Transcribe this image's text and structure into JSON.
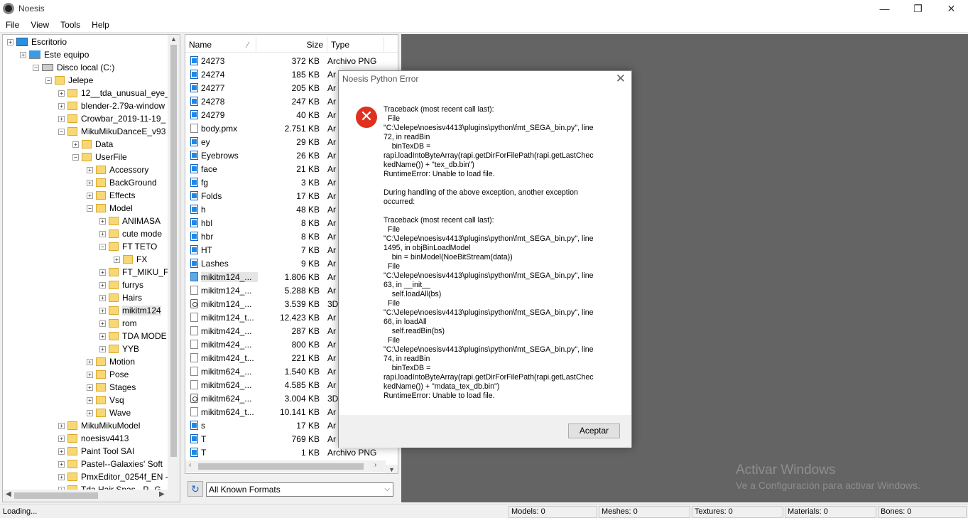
{
  "window": {
    "title": "Noesis",
    "minimize": "—",
    "restore": "❐",
    "close": "✕"
  },
  "menu": [
    "File",
    "View",
    "Tools",
    "Help"
  ],
  "tree": {
    "items": [
      {
        "label": "Escritorio",
        "exp": "+"
      },
      {
        "label": "Este equipo",
        "exp": "+"
      },
      {
        "label": "Disco local (C:)",
        "exp": "−"
      },
      {
        "label": "Jelepe",
        "exp": "−"
      },
      {
        "label": "12__tda_unusual_eye_",
        "exp": "+"
      },
      {
        "label": "blender-2.79a-window",
        "exp": "+"
      },
      {
        "label": "Crowbar_2019-11-19_",
        "exp": "+"
      },
      {
        "label": "MikuMikuDanceE_v93",
        "exp": "−"
      },
      {
        "label": "Data",
        "exp": "+"
      },
      {
        "label": "UserFile",
        "exp": "−"
      },
      {
        "label": "Accessory",
        "exp": "+"
      },
      {
        "label": "BackGround",
        "exp": "+"
      },
      {
        "label": "Effects",
        "exp": "+"
      },
      {
        "label": "Model",
        "exp": "−"
      },
      {
        "label": "ANIMASA",
        "exp": "+"
      },
      {
        "label": "cute mode",
        "exp": "+"
      },
      {
        "label": "FT TETO",
        "exp": "−"
      },
      {
        "label": "FX",
        "exp": "+"
      },
      {
        "label": "FT_MIKU_F",
        "exp": "+"
      },
      {
        "label": "furrys",
        "exp": "+"
      },
      {
        "label": "Hairs",
        "exp": "+"
      },
      {
        "label": "mikitm124",
        "exp": "+"
      },
      {
        "label": "rom",
        "exp": "+"
      },
      {
        "label": "TDA MODE",
        "exp": "+"
      },
      {
        "label": "YYB",
        "exp": "+"
      },
      {
        "label": "Motion",
        "exp": "+"
      },
      {
        "label": "Pose",
        "exp": "+"
      },
      {
        "label": "Stages",
        "exp": "+"
      },
      {
        "label": "Vsq",
        "exp": "+"
      },
      {
        "label": "Wave",
        "exp": "+"
      },
      {
        "label": "MikuMikuModel",
        "exp": "+"
      },
      {
        "label": "noesisv4413",
        "exp": "+"
      },
      {
        "label": "Paint Tool SAI",
        "exp": "+"
      },
      {
        "label": "Pastel--Galaxies' Soft",
        "exp": "+"
      },
      {
        "label": "PmxEditor_0254f_EN -",
        "exp": "+"
      },
      {
        "label": "Tda Hair Spas - P--G",
        "exp": "+"
      }
    ]
  },
  "file_list": {
    "headers": {
      "name": "Name",
      "size": "Size",
      "type": "Type"
    },
    "rows": [
      {
        "name": "24273",
        "size": "372 KB",
        "type": "Archivo PNG",
        "icon": "img"
      },
      {
        "name": "24274",
        "size": "185 KB",
        "type": "Ar",
        "icon": "img"
      },
      {
        "name": "24277",
        "size": "205 KB",
        "type": "Ar",
        "icon": "img"
      },
      {
        "name": "24278",
        "size": "247 KB",
        "type": "Ar",
        "icon": "img"
      },
      {
        "name": "24279",
        "size": "40 KB",
        "type": "Ar",
        "icon": "img"
      },
      {
        "name": "body.pmx",
        "size": "2.751 KB",
        "type": "Ar",
        "icon": "blank"
      },
      {
        "name": "ey",
        "size": "29 KB",
        "type": "Ar",
        "icon": "img"
      },
      {
        "name": "Eyebrows",
        "size": "26 KB",
        "type": "Ar",
        "icon": "img"
      },
      {
        "name": "face",
        "size": "21 KB",
        "type": "Ar",
        "icon": "img"
      },
      {
        "name": "fg",
        "size": "3 KB",
        "type": "Ar",
        "icon": "img"
      },
      {
        "name": "Folds",
        "size": "17 KB",
        "type": "Ar",
        "icon": "img"
      },
      {
        "name": "h",
        "size": "48 KB",
        "type": "Ar",
        "icon": "img"
      },
      {
        "name": "hbl",
        "size": "8 KB",
        "type": "Ar",
        "icon": "img"
      },
      {
        "name": "hbr",
        "size": "8 KB",
        "type": "Ar",
        "icon": "img"
      },
      {
        "name": "HT",
        "size": "7 KB",
        "type": "Ar",
        "icon": "img"
      },
      {
        "name": "Lashes",
        "size": "9 KB",
        "type": "Ar",
        "icon": "img"
      },
      {
        "name": "mikitm124_...",
        "size": "1.806 KB",
        "type": "Ar",
        "icon": "fill",
        "selected": true
      },
      {
        "name": "mikitm124_...",
        "size": "5.288 KB",
        "type": "Ar",
        "icon": "blank"
      },
      {
        "name": "mikitm124_...",
        "size": "3.539 KB",
        "type": "3D",
        "icon": "obj"
      },
      {
        "name": "mikitm124_t...",
        "size": "12.423 KB",
        "type": "Ar",
        "icon": "blank"
      },
      {
        "name": "mikitm424_...",
        "size": "287 KB",
        "type": "Ar",
        "icon": "blank"
      },
      {
        "name": "mikitm424_...",
        "size": "800 KB",
        "type": "Ar",
        "icon": "blank"
      },
      {
        "name": "mikitm424_t...",
        "size": "221 KB",
        "type": "Ar",
        "icon": "blank"
      },
      {
        "name": "mikitm624_...",
        "size": "1.540 KB",
        "type": "Ar",
        "icon": "blank"
      },
      {
        "name": "mikitm624_...",
        "size": "4.585 KB",
        "type": "Ar",
        "icon": "blank"
      },
      {
        "name": "mikitm624_...",
        "size": "3.004 KB",
        "type": "3D",
        "icon": "obj"
      },
      {
        "name": "mikitm624_t...",
        "size": "10.141 KB",
        "type": "Ar",
        "icon": "blank"
      },
      {
        "name": "s",
        "size": "17 KB",
        "type": "Ar",
        "icon": "img"
      },
      {
        "name": "T",
        "size": "769 KB",
        "type": "Ar",
        "icon": "img"
      },
      {
        "name": "T",
        "size": "1 KB",
        "type": "Archivo PNG",
        "icon": "img"
      }
    ]
  },
  "format_filter": {
    "selected": "All Known Formats"
  },
  "watermark": {
    "line1": "Activar Windows",
    "line2": "Ve a Configuración para activar Windows."
  },
  "status": {
    "left": "Loading...",
    "models": "Models: 0",
    "meshes": "Meshes: 0",
    "textures": "Textures: 0",
    "materials": "Materials: 0",
    "bones": "Bones: 0"
  },
  "dialog": {
    "title": "Noesis Python Error",
    "close": "✕",
    "icon": "✕",
    "message": "Traceback (most recent call last):\n  File\n\"C:\\Jelepe\\noesisv4413\\plugins\\python\\fmt_SEGA_bin.py\", line\n72, in readBin\n    binTexDB =\nrapi.loadIntoByteArray(rapi.getDirForFilePath(rapi.getLastChec\nkedName()) + \"tex_db.bin\")\nRuntimeError: Unable to load file.\n\nDuring handling of the above exception, another exception\noccurred:\n\nTraceback (most recent call last):\n  File\n\"C:\\Jelepe\\noesisv4413\\plugins\\python\\fmt_SEGA_bin.py\", line\n1495, in objBinLoadModel\n    bin = binModel(NoeBitStream(data))\n  File\n\"C:\\Jelepe\\noesisv4413\\plugins\\python\\fmt_SEGA_bin.py\", line\n63, in __init__\n    self.loadAll(bs)\n  File\n\"C:\\Jelepe\\noesisv4413\\plugins\\python\\fmt_SEGA_bin.py\", line\n66, in loadAll\n    self.readBin(bs)\n  File\n\"C:\\Jelepe\\noesisv4413\\plugins\\python\\fmt_SEGA_bin.py\", line\n74, in readBin\n    binTexDB =\nrapi.loadIntoByteArray(rapi.getDirForFilePath(rapi.getLastChec\nkedName()) + \"mdata_tex_db.bin\")\nRuntimeError: Unable to load file.",
    "ok_label": "Aceptar"
  },
  "colors": {
    "viewport": "#646464",
    "error_red": "#e0301e",
    "folder": "#f8d775",
    "accent_blue": "#1e88e5"
  }
}
